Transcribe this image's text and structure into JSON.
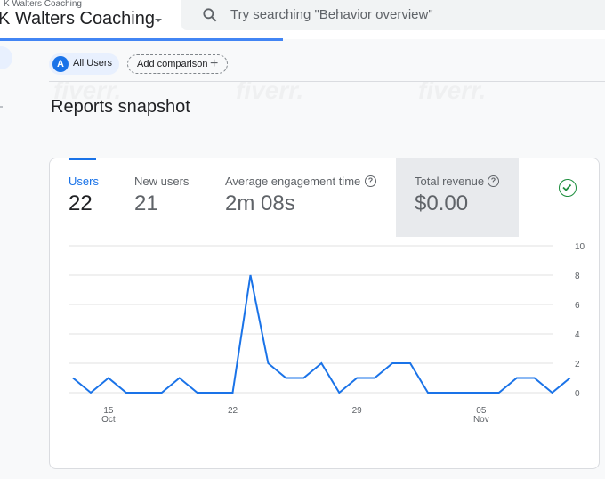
{
  "header": {
    "account_subtitle": "K Walters Coaching",
    "account_name": "K Walters Coaching"
  },
  "search": {
    "placeholder": "Try searching \"Behavior overview\""
  },
  "comparison": {
    "all_users_avatar": "A",
    "all_users_label": "All Users",
    "add_label": "Add comparison",
    "add_icon": "+"
  },
  "page_title": "Reports snapshot",
  "metrics": [
    {
      "label": "Users",
      "value": "22"
    },
    {
      "label": "New users",
      "value": "21"
    },
    {
      "label": "Average engagement time",
      "value": "2m 08s"
    },
    {
      "label": "Total revenue",
      "value": "$0.00"
    }
  ],
  "help_glyph": "?",
  "watermark": "fiverr.",
  "colors": {
    "accent": "#1a73e8",
    "line": "#1a73e8",
    "check": "#1e8e3e"
  },
  "icons": {
    "search": "search-icon",
    "check": "check-circle-icon",
    "help": "help-circle-icon"
  },
  "chart_data": {
    "type": "line",
    "x": [
      "Oct 13",
      "Oct 14",
      "Oct 15",
      "Oct 16",
      "Oct 17",
      "Oct 18",
      "Oct 19",
      "Oct 20",
      "Oct 21",
      "Oct 22",
      "Oct 23",
      "Oct 24",
      "Oct 25",
      "Oct 26",
      "Oct 27",
      "Oct 28",
      "Oct 29",
      "Oct 30",
      "Oct 31",
      "Nov 1",
      "Nov 2",
      "Nov 3",
      "Nov 4",
      "Nov 5",
      "Nov 6",
      "Nov 7",
      "Nov 8",
      "Nov 9",
      "Nov 10",
      "Nov 11"
    ],
    "series": [
      {
        "values": [
          1,
          0,
          1,
          0,
          0,
          0,
          1,
          0,
          0,
          0,
          8,
          2,
          1,
          1,
          2,
          0,
          1,
          1,
          2,
          2,
          0,
          0,
          0,
          0,
          0,
          1,
          1,
          0,
          1
        ]
      }
    ],
    "x_tick_labels": [
      {
        "label": "15",
        "sub": "Oct",
        "index": 2
      },
      {
        "label": "22",
        "sub": "",
        "index": 9
      },
      {
        "label": "29",
        "sub": "",
        "index": 16
      },
      {
        "label": "05",
        "sub": "Nov",
        "index": 23
      }
    ],
    "y_ticks": [
      0,
      2,
      4,
      6,
      8,
      10
    ],
    "ylim": [
      0,
      10
    ]
  }
}
